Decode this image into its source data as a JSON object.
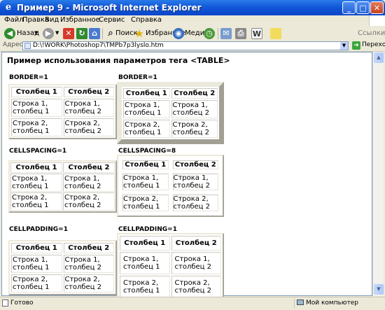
{
  "window": {
    "title": "Пример 9 - Microsoft Internet Explorer",
    "minimize": "_",
    "maximize": "□",
    "close": "✕"
  },
  "menu": [
    "Файл",
    "Правка",
    "Вид",
    "Избранное",
    "Сервис",
    "Справка"
  ],
  "toolbar": {
    "back": "Назад",
    "search": "Поиск",
    "favorites": "Избранное",
    "media": "Медиа",
    "links": "Ссылки"
  },
  "address": {
    "label": "Адрес:",
    "value": "D:\\!WORK\\Photoshop7\\TMPb7p3lyslo.htm",
    "go": "Переход"
  },
  "page": {
    "heading": "Пример использования параметров тега <TABLE>",
    "tables": [
      {
        "caption": "BORDER=1",
        "headers": [
          "Столбец 1",
          "Столбец 2"
        ],
        "rows": [
          [
            "Строка 1, столбец 1",
            "Строка 1, столбец 2"
          ],
          [
            "Строка 2, столбец 1",
            "Строка 2, столбец 2"
          ]
        ]
      },
      {
        "caption": "BORDER=1",
        "headers": [
          "Столбец 1",
          "Столбец 2"
        ],
        "rows": [
          [
            "Строка 1, столбец 1",
            "Строка 1, столбец 2"
          ],
          [
            "Строка 2, столбец 1",
            "Строка 2, столбец 2"
          ]
        ]
      },
      {
        "caption": "CELLSPACING=1",
        "headers": [
          "Столбец 1",
          "Столбец 2"
        ],
        "rows": [
          [
            "Строка 1, столбец 1",
            "Строка 1, столбец 2"
          ],
          [
            "Строка 2, столбец 1",
            "Строка 2, столбец 2"
          ]
        ]
      },
      {
        "caption": "CELLSPACING=8",
        "headers": [
          "Столбец 1",
          "Столбец 2"
        ],
        "rows": [
          [
            "Строка 1, столбец 1",
            "Строка 1, столбец 2"
          ],
          [
            "Строка 2, столбец 1",
            "Строка 2, столбец 2"
          ]
        ]
      },
      {
        "caption": "CELLPADDING=1",
        "headers": [
          "Столбец 1",
          "Столбец 2"
        ],
        "rows": [
          [
            "Строка 1, столбец 1",
            "Строка 1, столбец 2"
          ],
          [
            "Строка 2, столбец 1",
            "Строка 2, столбец 2"
          ]
        ]
      },
      {
        "caption": "CELLPADDING=1",
        "headers": [
          "Столбец 1",
          "Столбец 2"
        ],
        "rows": [
          [
            "Строка 1, столбец 1",
            "Строка 1, столбец 2"
          ],
          [
            "Строка 2, столбец 1",
            "Строка 2, столбец 2"
          ]
        ]
      }
    ]
  },
  "status": {
    "text": "Готово",
    "zone": "Мой компьютер"
  },
  "icons": {
    "back": "back-arrow-icon",
    "forward": "forward-arrow-icon",
    "stop": "stop-icon",
    "refresh": "refresh-icon",
    "home": "home-icon",
    "search": "search-icon",
    "favorites": "favorites-star-icon",
    "media": "media-icon",
    "history": "history-icon",
    "mail": "mail-icon",
    "print": "print-icon",
    "edit": "edit-icon",
    "messenger": "messenger-icon"
  },
  "colors": {
    "titlebar": "#0a46c8",
    "chrome": "#ece9d8",
    "content": "#ffffff"
  }
}
